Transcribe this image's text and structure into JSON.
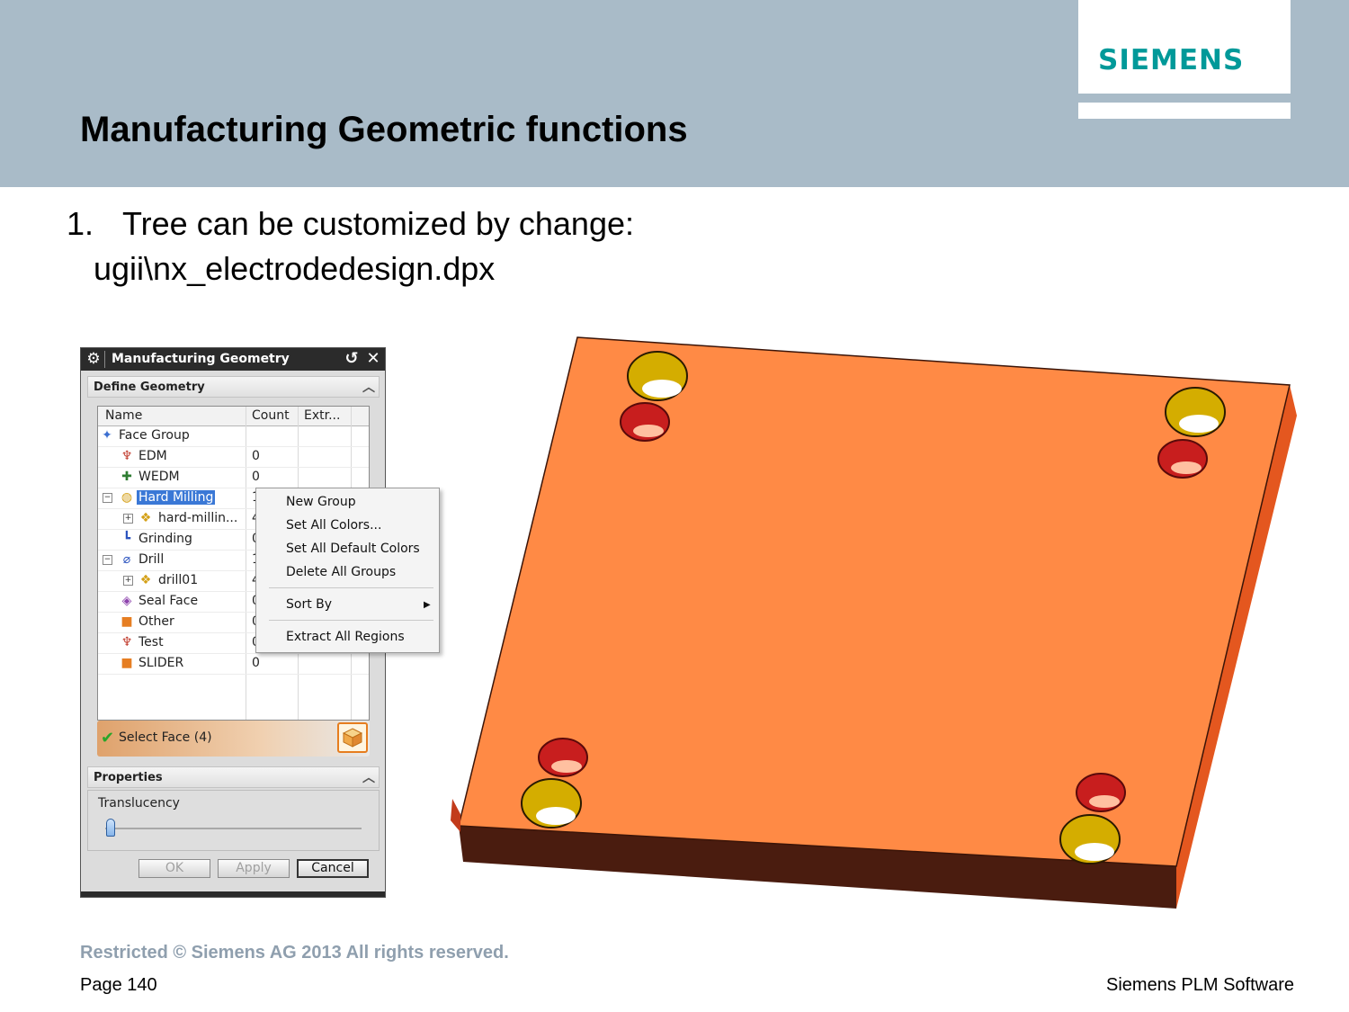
{
  "header": {
    "logo": "SIEMENS",
    "title": "Manufacturing Geometric functions"
  },
  "body": {
    "bullet_number": "1.",
    "bullet_text": "Tree can be customized by change:",
    "bullet_path": "ugii\\nx_electrodedesign.dpx"
  },
  "dialog": {
    "title": "Manufacturing Geometry",
    "section_geometry": "Define Geometry",
    "columns": [
      "Name",
      "Count",
      "Extr..."
    ],
    "rows": [
      {
        "name": "Face Group",
        "count": "",
        "icon": "face-group-icon"
      },
      {
        "name": "EDM",
        "count": "0",
        "icon": "edm-icon"
      },
      {
        "name": "WEDM",
        "count": "0",
        "icon": "wedm-icon"
      },
      {
        "name": "Hard Milling",
        "count": "1",
        "icon": "hard-milling-icon"
      },
      {
        "name": "hard-millin...",
        "count": "4",
        "icon": "group-cubes-icon"
      },
      {
        "name": "Grinding",
        "count": "0",
        "icon": "grinding-icon"
      },
      {
        "name": "Drill",
        "count": "1",
        "icon": "drill-icon"
      },
      {
        "name": "drill01",
        "count": "4",
        "icon": "group-cubes-icon"
      },
      {
        "name": "Seal Face",
        "count": "0",
        "icon": "seal-face-icon"
      },
      {
        "name": "Other",
        "count": "0",
        "icon": "other-box-icon"
      },
      {
        "name": "Test",
        "count": "0",
        "icon": "test-icon"
      },
      {
        "name": "SLIDER",
        "count": "0",
        "icon": "slider-box-icon"
      }
    ],
    "select_face": "Select Face (4)",
    "section_properties": "Properties",
    "translucency_label": "Translucency",
    "translucency_value": 0,
    "buttons": {
      "ok": "OK",
      "apply": "Apply",
      "cancel": "Cancel"
    }
  },
  "context_menu": {
    "items": [
      "New Group",
      "Set All Colors...",
      "Set All Default Colors",
      "Delete All Groups",
      "Sort By",
      "Extract All Regions"
    ]
  },
  "footer": {
    "restricted": "Restricted © Siemens AG 2013 All rights reserved.",
    "page": "Page 140",
    "brand": "Siemens PLM Software"
  },
  "colors": {
    "header_band": "#a9bbc8",
    "logo_teal": "#009999",
    "plate_top": "#ff8a45",
    "plate_side": "#e4571f",
    "plate_front": "#4a1c0f",
    "selection_blue": "#3a78d6"
  }
}
